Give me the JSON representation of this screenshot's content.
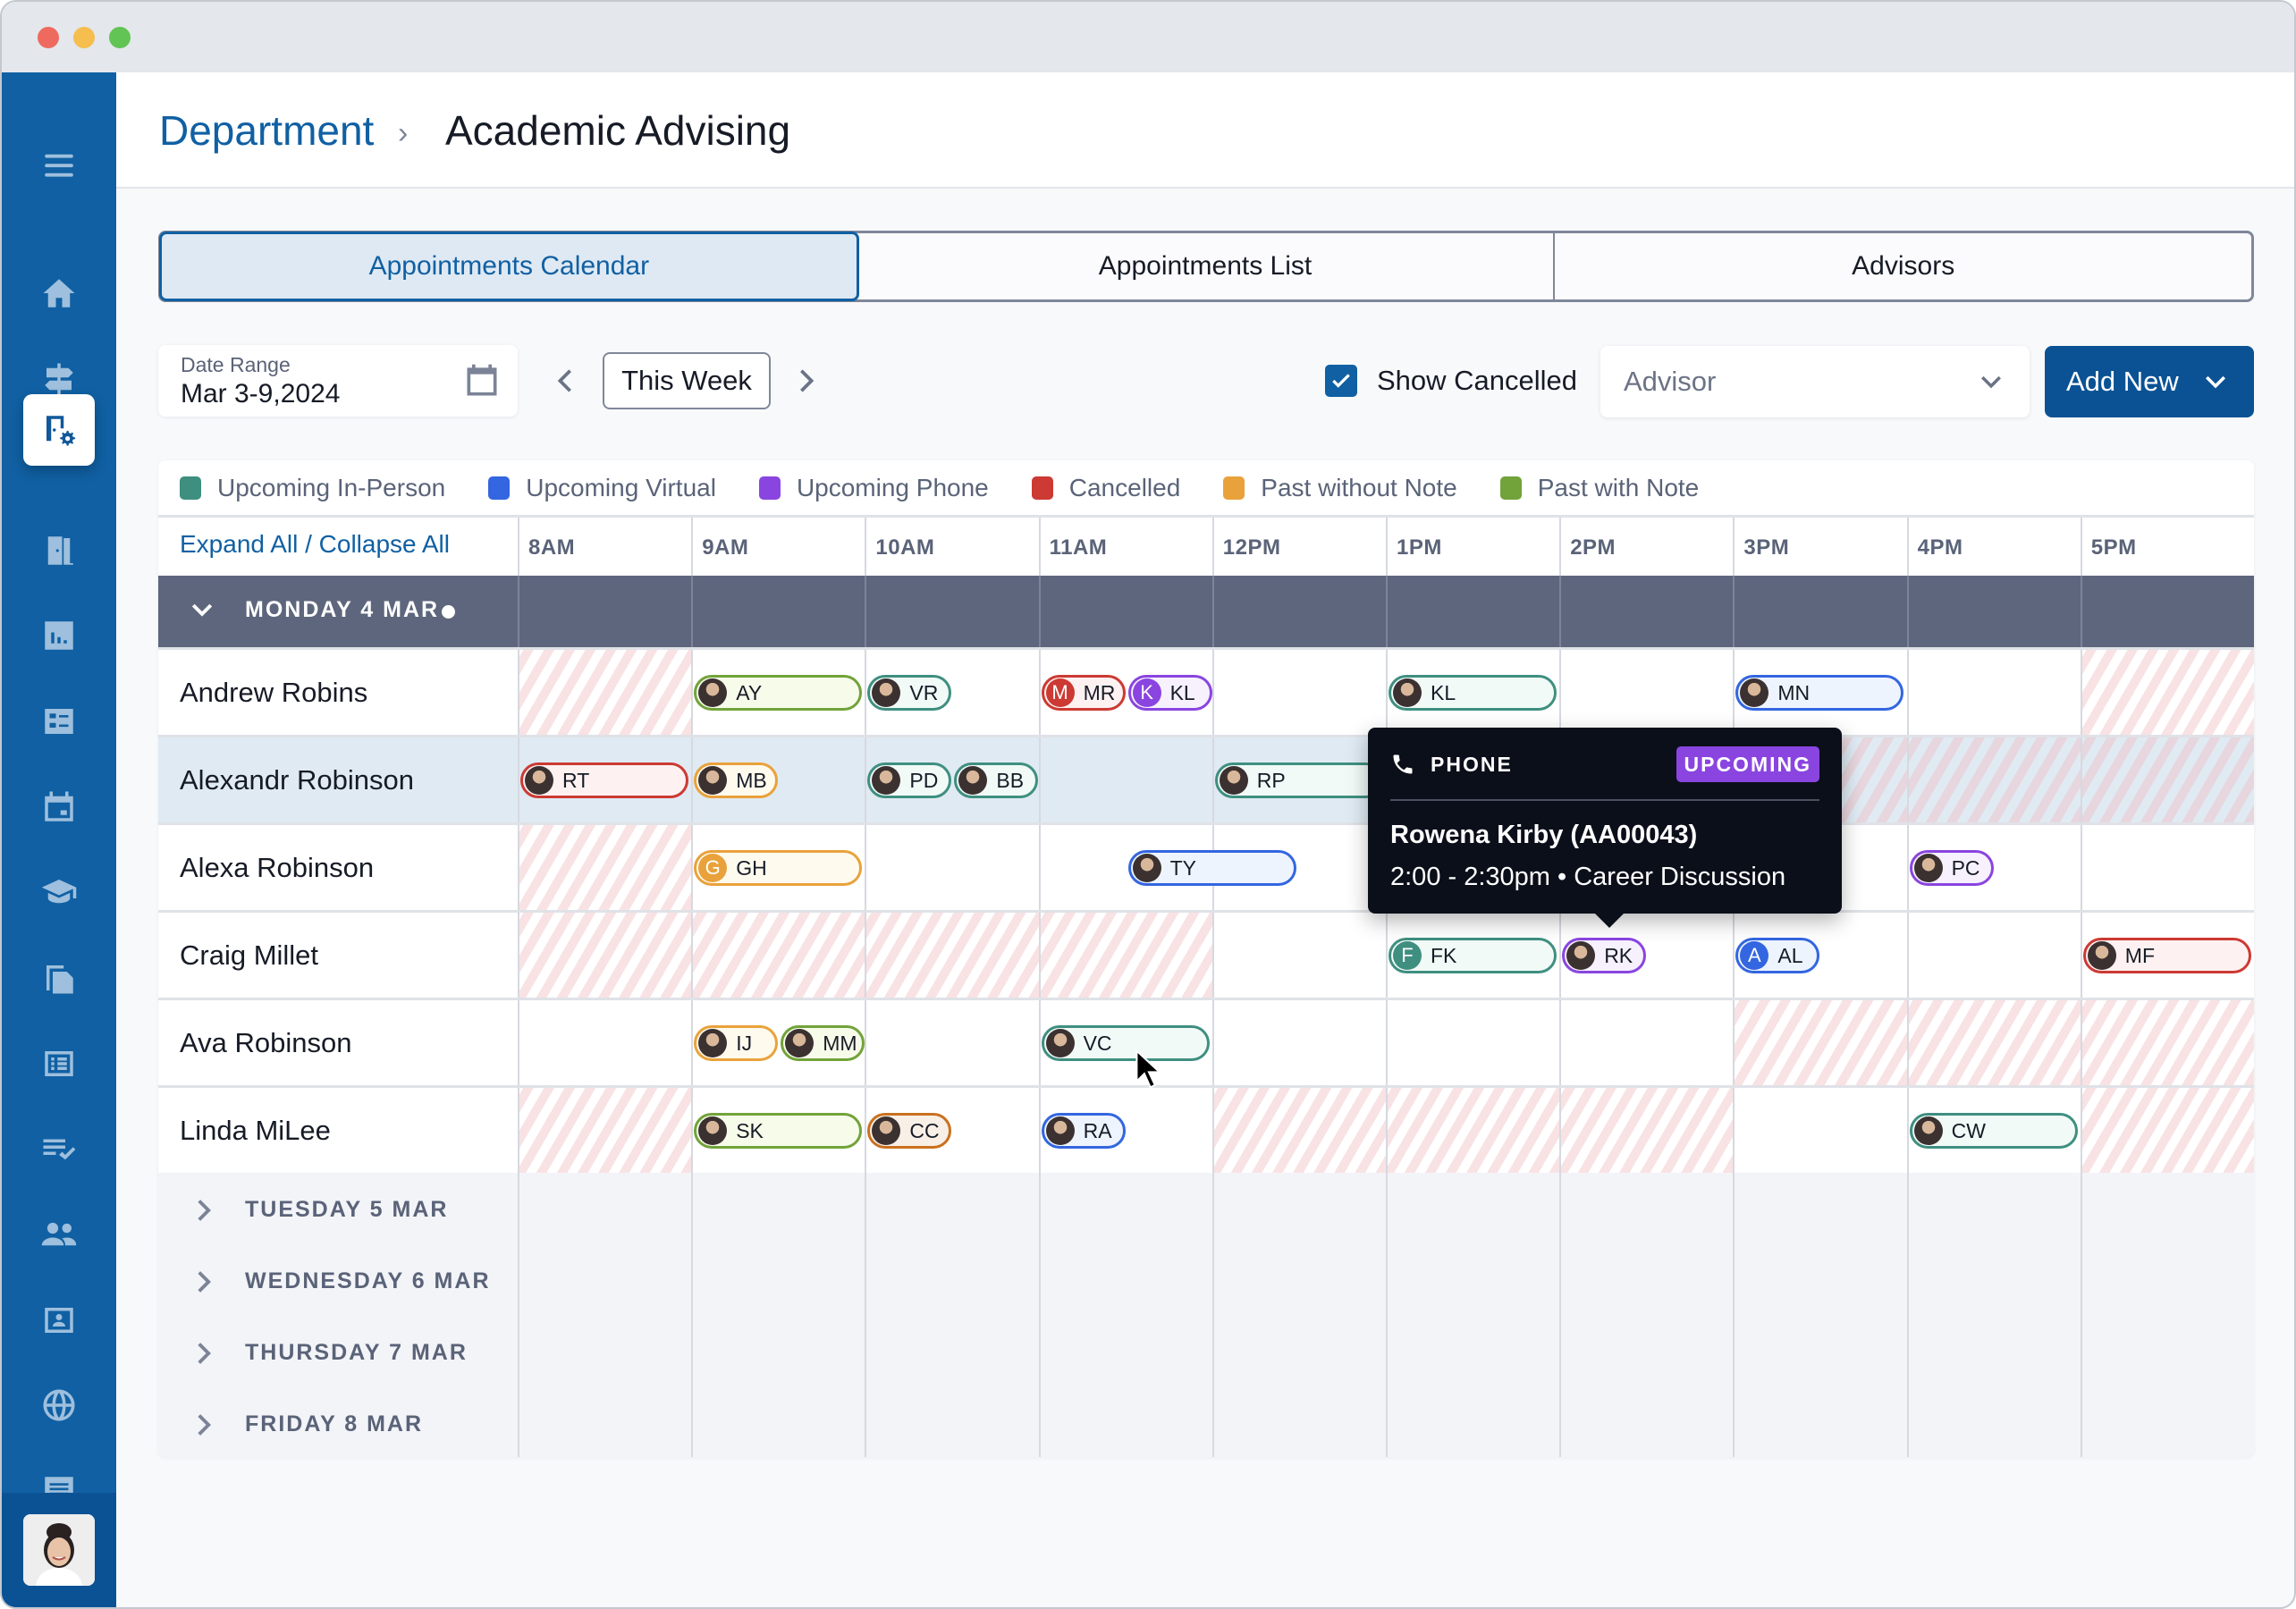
{
  "window": {
    "controls": [
      "close",
      "minimize",
      "maximize"
    ]
  },
  "sidebar": {
    "items": [
      {
        "icon": "menu-icon",
        "active": false
      },
      {
        "icon": "home-icon",
        "active": false
      },
      {
        "icon": "signpost-icon",
        "active": false
      },
      {
        "icon": "department-settings-icon",
        "active": true
      },
      {
        "icon": "door-icon",
        "active": false
      },
      {
        "icon": "bar-chart-icon",
        "active": false
      },
      {
        "icon": "checklist-grid-icon",
        "active": false
      },
      {
        "icon": "calendar-icon",
        "active": false
      },
      {
        "icon": "graduation-cap-icon",
        "active": false
      },
      {
        "icon": "documents-icon",
        "active": false
      },
      {
        "icon": "list-icon",
        "active": false
      },
      {
        "icon": "task-list-check-icon",
        "active": false
      },
      {
        "icon": "people-icon",
        "active": false
      },
      {
        "icon": "contact-card-icon",
        "active": false
      },
      {
        "icon": "globe-icon",
        "active": false
      },
      {
        "icon": "chat-icon",
        "active": false
      }
    ],
    "user_avatar": "user-avatar"
  },
  "header": {
    "breadcrumb_parent": "Department",
    "breadcrumb_separator": "›",
    "title": "Academic Advising"
  },
  "tabs": [
    {
      "label": "Appointments Calendar",
      "active": true
    },
    {
      "label": "Appointments List",
      "active": false
    },
    {
      "label": "Advisors",
      "active": false
    }
  ],
  "controls": {
    "date_range_label": "Date Range",
    "date_range_value": "Mar 3-9,2024",
    "week_button": "This Week",
    "show_cancelled_label": "Show Cancelled",
    "show_cancelled_checked": true,
    "advisor_placeholder": "Advisor",
    "add_new_label": "Add New"
  },
  "legend": [
    {
      "label": "Upcoming In-Person",
      "color": "#3f8f80"
    },
    {
      "label": "Upcoming Virtual",
      "color": "#3366e0"
    },
    {
      "label": "Upcoming Phone",
      "color": "#8a45e0"
    },
    {
      "label": "Cancelled",
      "color": "#cc3a33"
    },
    {
      "label": "Past without Note",
      "color": "#e9a23b"
    },
    {
      "label": "Past with Note",
      "color": "#72a33a"
    }
  ],
  "calendar": {
    "expand_all": "Expand All",
    "slash": " / ",
    "collapse_all": "Collapse All",
    "hours": [
      "8AM",
      "9AM",
      "10AM",
      "11AM",
      "12PM",
      "1PM",
      "2PM",
      "3PM",
      "4PM",
      "5PM"
    ],
    "expanded_day": {
      "label": "MONDAY 4 MAR",
      "today_marker": true
    },
    "advisors": [
      {
        "name": "Andrew Robins",
        "blocked_hours": [
          0,
          9
        ],
        "appointments": [
          {
            "initials": "AY",
            "status": "past_with_note",
            "hour": 1,
            "offset": 0,
            "wide": true,
            "avatar": "photo"
          },
          {
            "initials": "VR",
            "status": "in_person",
            "hour": 2,
            "offset": 0,
            "wide": false,
            "avatar": "photo"
          },
          {
            "initials": "MR",
            "status": "cancelled",
            "hour": 3,
            "offset": 0,
            "wide": false,
            "avatar": "letter",
            "letter": "M"
          },
          {
            "initials": "KL",
            "status": "phone",
            "hour": 3,
            "offset": 1,
            "wide": false,
            "avatar": "letter",
            "letter": "K"
          },
          {
            "initials": "KL",
            "status": "in_person",
            "hour": 5,
            "offset": 0,
            "wide": true,
            "avatar": "photo"
          },
          {
            "initials": "MN",
            "status": "virtual",
            "hour": 7,
            "offset": 0,
            "wide": true,
            "avatar": "photo"
          }
        ]
      },
      {
        "name": "Alexandr Robinson",
        "selected": true,
        "blocked_hours": [
          7,
          8,
          9
        ],
        "appointments": [
          {
            "initials": "RT",
            "status": "cancelled",
            "hour": 0,
            "offset": 0,
            "wide": true,
            "avatar": "photo"
          },
          {
            "initials": "MB",
            "status": "past_without_note",
            "hour": 1,
            "offset": 0,
            "wide": false,
            "avatar": "photo"
          },
          {
            "initials": "PD",
            "status": "in_person",
            "hour": 2,
            "offset": 0,
            "wide": false,
            "avatar": "photo"
          },
          {
            "initials": "BB",
            "status": "in_person",
            "hour": 2,
            "offset": 1,
            "wide": false,
            "avatar": "photo"
          },
          {
            "initials": "RP",
            "status": "in_person",
            "hour": 4,
            "offset": 0,
            "wide": true,
            "avatar": "photo"
          }
        ]
      },
      {
        "name": "Alexa Robinson",
        "blocked_hours": [
          0
        ],
        "appointments": [
          {
            "initials": "GH",
            "status": "past_without_note",
            "hour": 1,
            "offset": 0,
            "wide": true,
            "avatar": "letter",
            "letter": "G"
          },
          {
            "initials": "TY",
            "status": "virtual",
            "hour": 3,
            "offset": 1,
            "wide": true,
            "avatar": "photo"
          },
          {
            "initials": "PC",
            "status": "phone",
            "hour": 8,
            "offset": 0,
            "wide": false,
            "avatar": "photo"
          }
        ]
      },
      {
        "name": "Craig Millet",
        "blocked_hours": [
          0,
          1,
          2,
          3
        ],
        "appointments": [
          {
            "initials": "FK",
            "status": "in_person",
            "hour": 5,
            "offset": 0,
            "wide": true,
            "avatar": "letter",
            "letter": "F"
          },
          {
            "initials": "RK",
            "status": "phone",
            "hour": 6,
            "offset": 0,
            "wide": false,
            "avatar": "photo"
          },
          {
            "initials": "AL",
            "status": "virtual",
            "hour": 7,
            "offset": 0,
            "wide": false,
            "avatar": "letter",
            "letter": "A"
          },
          {
            "initials": "MF",
            "status": "cancelled",
            "hour": 9,
            "offset": 0,
            "wide": true,
            "avatar": "photo"
          }
        ]
      },
      {
        "name": "Ava Robinson",
        "blocked_hours": [
          7,
          8,
          9
        ],
        "appointments": [
          {
            "initials": "IJ",
            "status": "past_without_note",
            "hour": 1,
            "offset": 0,
            "wide": false,
            "avatar": "photo"
          },
          {
            "initials": "MM",
            "status": "past_with_note",
            "hour": 1,
            "offset": 1,
            "wide": false,
            "avatar": "photo"
          },
          {
            "initials": "VC",
            "status": "in_person",
            "hour": 3,
            "offset": 0,
            "wide": true,
            "avatar": "photo"
          }
        ]
      },
      {
        "name": "Linda MiLee",
        "blocked_hours": [
          0,
          4,
          5,
          6,
          9
        ],
        "appointments": [
          {
            "initials": "SK",
            "status": "past_with_note",
            "hour": 1,
            "offset": 0,
            "wide": true,
            "avatar": "photo"
          },
          {
            "initials": "CC",
            "status": "past_without_note_dark",
            "hour": 2,
            "offset": 0,
            "wide": false,
            "avatar": "photo"
          },
          {
            "initials": "RA",
            "status": "virtual",
            "hour": 3,
            "offset": 0,
            "wide": false,
            "avatar": "photo"
          },
          {
            "initials": "CW",
            "status": "in_person",
            "hour": 8,
            "offset": 0,
            "wide": true,
            "avatar": "photo"
          }
        ]
      }
    ],
    "collapsed_days": [
      "TUESDAY 5 MAR",
      "WEDNESDAY 6 MAR",
      "THURSDAY 7 MAR",
      "FRIDAY 8 MAR"
    ]
  },
  "status_colors": {
    "in_person": {
      "border": "#3f8f80",
      "fill": "#f1faf7"
    },
    "virtual": {
      "border": "#3366e0",
      "fill": "#eef4fd"
    },
    "phone": {
      "border": "#8a45e0",
      "fill": "#f6f1fd"
    },
    "cancelled": {
      "border": "#cc3a33",
      "fill": "#fdf1f1"
    },
    "past_without_note": {
      "border": "#e9a23b",
      "fill": "#fffaee"
    },
    "past_without_note_dark": {
      "border": "#c9711f",
      "fill": "#f8efe6"
    },
    "past_with_note": {
      "border": "#72a33a",
      "fill": "#f6fbea"
    }
  },
  "tooltip": {
    "type_label": "PHONE",
    "badge": "UPCOMING",
    "student": "Rowena Kirby (AA00043)",
    "detail": "2:00 - 2:30pm • Career Discussion"
  }
}
